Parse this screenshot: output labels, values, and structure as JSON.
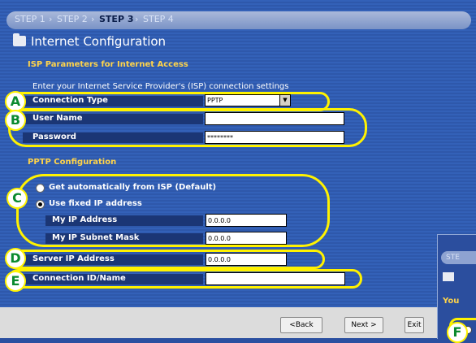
{
  "wizard": {
    "steps": [
      "STEP 1",
      "STEP 2",
      "STEP 3",
      "STEP 4"
    ],
    "separator": "›",
    "current_step": "STEP 3",
    "title": "Internet Configuration"
  },
  "isp": {
    "section_title": "ISP Parameters for Internet Access",
    "instructions": "Enter your Internet Service Provider's (ISP) connection settings",
    "connection_type_label": "Connection Type",
    "connection_type_value": "PPTP",
    "user_name_label": "User Name",
    "user_name_value": "",
    "password_label": "Password",
    "password_value": "********"
  },
  "pptp": {
    "section_title": "PPTP Configuration",
    "option_auto": "Get automatically from ISP (Default)",
    "option_fixed": "Use fixed IP address",
    "ip_label": "My IP Address",
    "ip_value": "0.0.0.0",
    "mask_label": "My IP Subnet Mask",
    "mask_value": "0.0.0.0",
    "server_label": "Server IP Address",
    "server_value": "0.0.0.0",
    "connid_label": "Connection ID/Name",
    "connid_value": ""
  },
  "callouts": [
    "A",
    "B",
    "C",
    "D",
    "E",
    "F"
  ],
  "buttons": {
    "back": "<Back",
    "next": "Next >",
    "exit": "Exit"
  },
  "inset": {
    "step_text": "STE",
    "section_text": "You"
  },
  "colors": {
    "panel": "#3361b8",
    "section_heading": "#ffd44a",
    "callout_outline": "#fff200",
    "callout_letter": "#0a8a2e"
  }
}
